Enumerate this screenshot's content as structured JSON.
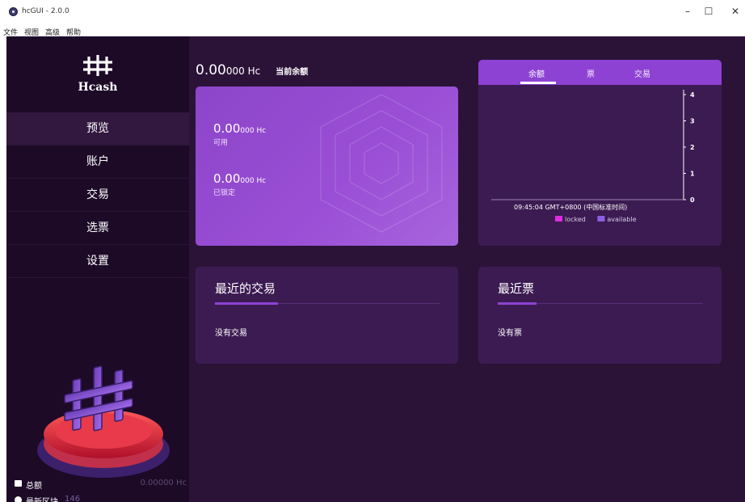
{
  "window": {
    "title": "hcGUI - 2.0.0",
    "controls": [
      "–",
      "☐",
      "✕"
    ]
  },
  "menu": [
    "文件",
    "视图",
    "高级",
    "帮助"
  ],
  "sidebar": {
    "logo_text": "Hcash",
    "items": [
      {
        "label": "预览",
        "active": true
      },
      {
        "label": "账户",
        "active": false
      },
      {
        "label": "交易",
        "active": false
      },
      {
        "label": "选票",
        "active": false
      },
      {
        "label": "设置",
        "active": false
      }
    ],
    "total_label": "总额",
    "total_value": "0.00000 Hc",
    "latest_block_label": "最新区块",
    "latest_block_value": "146"
  },
  "balance": {
    "big": "0.00",
    "small": "000 Hc",
    "label": "当前余额"
  },
  "balance_card": {
    "available_big": "0.00",
    "available_small": "000 Hc",
    "available_label": "可用",
    "locked_big": "0.00",
    "locked_small": "000 Hc",
    "locked_label": "已锁定"
  },
  "chart_card": {
    "tabs": [
      "余额",
      "票",
      "交易"
    ],
    "active_tab": "余额"
  },
  "chart_data": {
    "type": "bar",
    "categories": [
      "09:45:04 GMT+0800 (中国标准时间)"
    ],
    "series": [
      {
        "name": "locked",
        "values": [
          0
        ],
        "color": "#e02be0"
      },
      {
        "name": "available",
        "values": [
          0
        ],
        "color": "#8b5fe0"
      }
    ],
    "y_ticks": [
      "0",
      "1",
      "2",
      "3",
      "4"
    ],
    "ylim": [
      0,
      4
    ],
    "legend_position": "bottom"
  },
  "recent_transactions": {
    "title": "最近的交易",
    "empty": "没有交易"
  },
  "recent_tickets": {
    "title": "最近票",
    "empty": "没有票"
  },
  "colors": {
    "app_bg": "#2b1338",
    "sidebar_bg": "#1c0a27",
    "accent": "#8e42d3",
    "card_bg": "#3c1b52"
  }
}
